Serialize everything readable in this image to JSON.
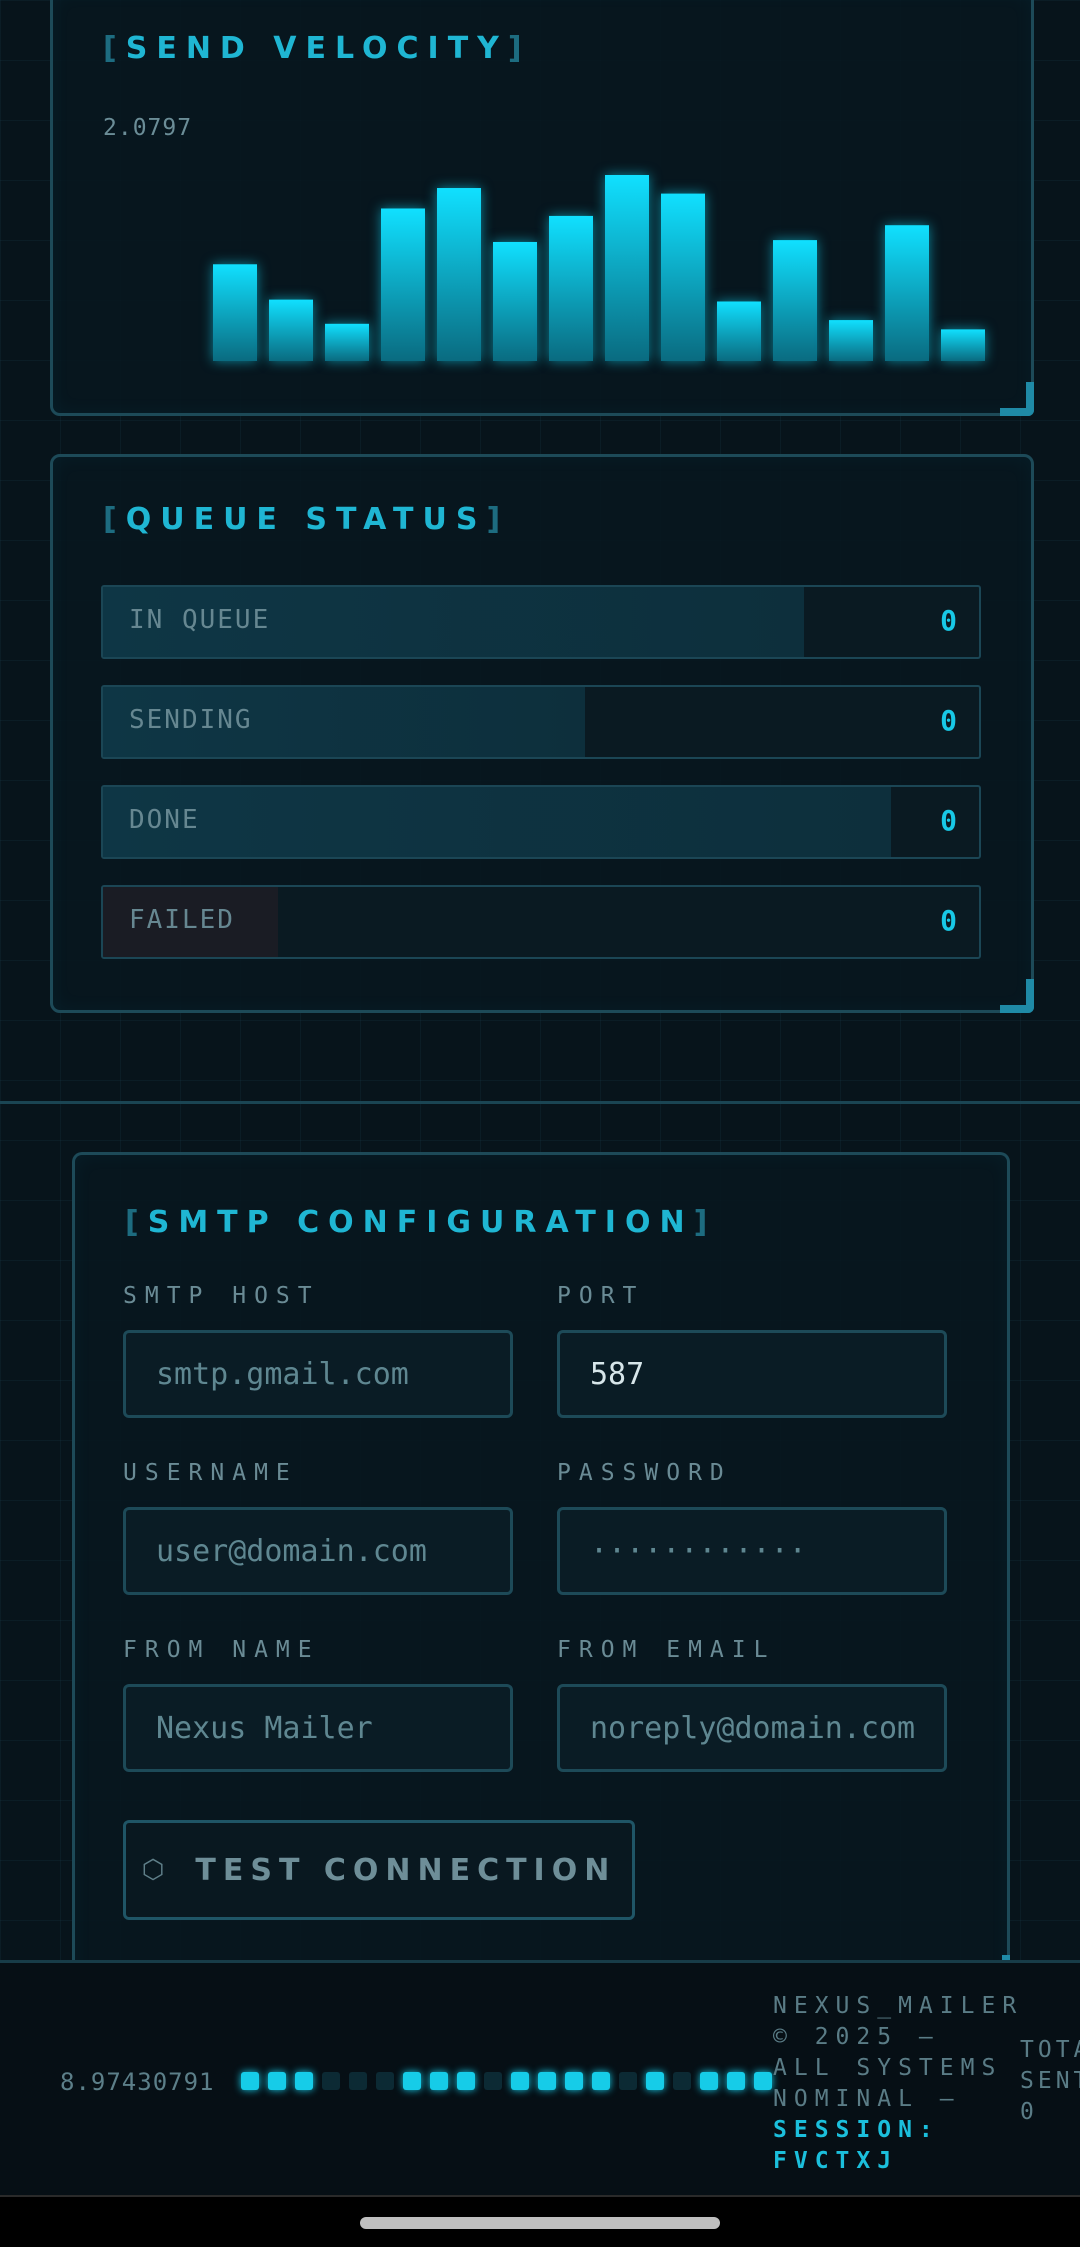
{
  "velocity": {
    "title": "SEND VELOCITY",
    "readout": "2.0797",
    "bars": [
      0.52,
      0.33,
      0.2,
      0.82,
      0.93,
      0.64,
      0.78,
      1.0,
      0.9,
      0.32,
      0.65,
      0.22,
      0.73,
      0.17
    ]
  },
  "queue": {
    "title": "QUEUE STATUS",
    "rows": [
      {
        "label": "IN QUEUE",
        "value": "0",
        "fill": 0.8
      },
      {
        "label": "SENDING",
        "value": "0",
        "fill": 0.55
      },
      {
        "label": "DONE",
        "value": "0",
        "fill": 0.9
      },
      {
        "label": "FAILED",
        "value": "0",
        "fill": 0.2
      }
    ]
  },
  "smtp": {
    "title": "SMTP CONFIGURATION",
    "host_label": "SMTP HOST",
    "host_placeholder": "smtp.gmail.com",
    "port_label": "PORT",
    "port_value": "587",
    "username_label": "USERNAME",
    "username_placeholder": "user@domain.com",
    "password_label": "PASSWORD",
    "password_placeholder": "············",
    "from_name_label": "FROM NAME",
    "from_name_placeholder": "Nexus Mailer",
    "from_email_label": "FROM EMAIL",
    "from_email_placeholder": "noreply@domain.com",
    "test_button": "TEST CONNECTION",
    "test_icon": "⬡"
  },
  "footer": {
    "number": "8.97430791",
    "leds": [
      1,
      1,
      1,
      0,
      0,
      0,
      1,
      1,
      1,
      0,
      1,
      1,
      1,
      1,
      0,
      1,
      0,
      1,
      1,
      1
    ],
    "copyright": "NEXUS_MAILER © 2025 — ALL SYSTEMS NOMINAL —",
    "session": "SESSION: FVCTXJ",
    "total_label": "TOTAL",
    "sent_label": "SENT:",
    "sent_value": "0"
  }
}
